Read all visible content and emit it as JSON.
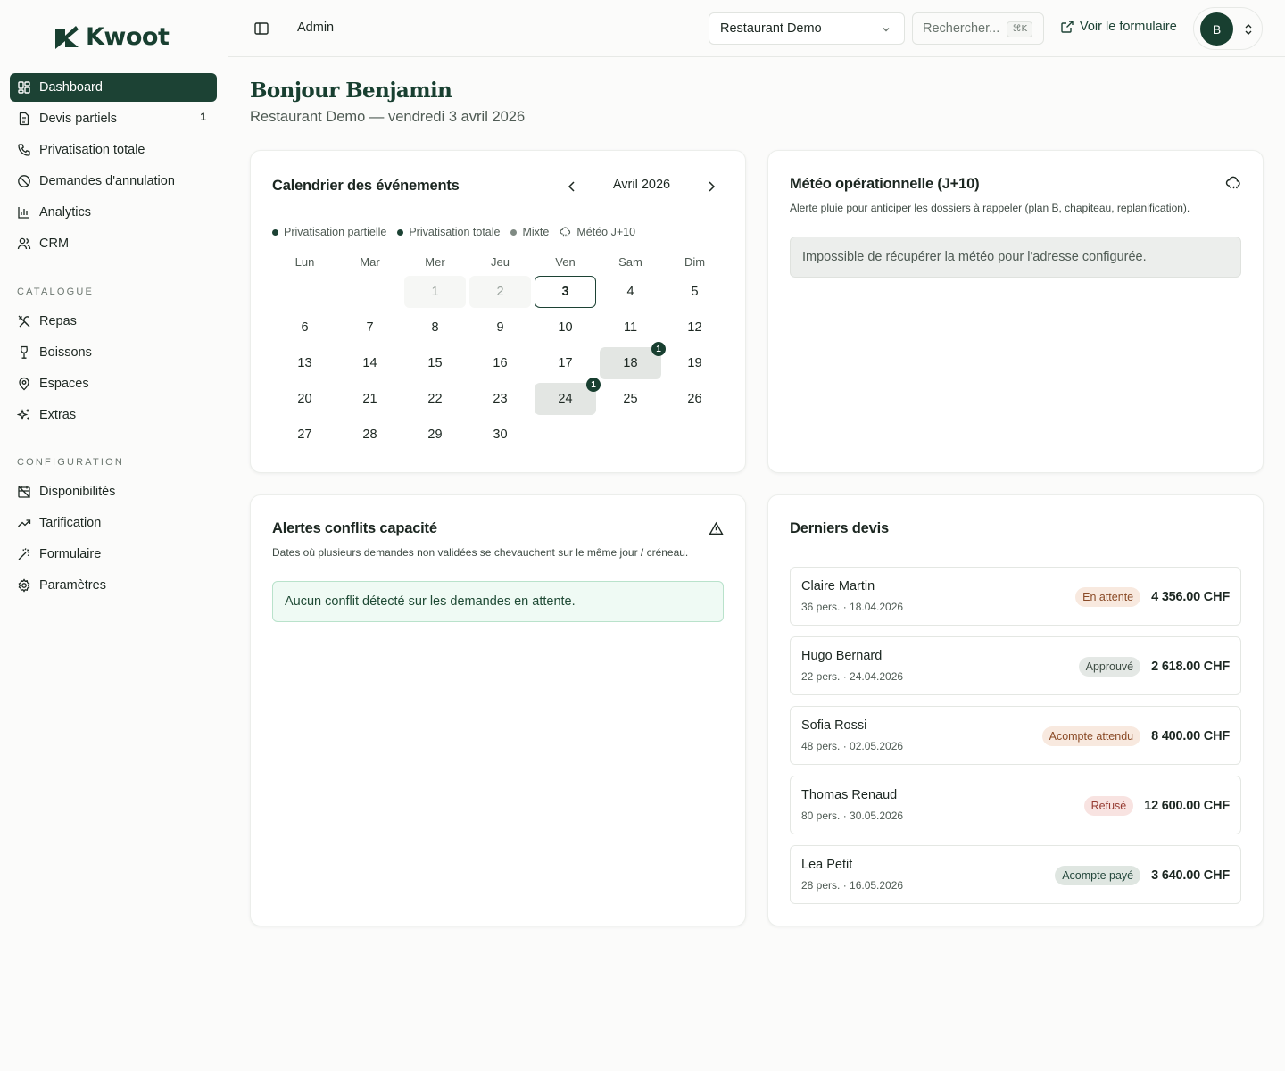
{
  "brand": {
    "name": "Kwoot",
    "color": "#183f30"
  },
  "sidebar": {
    "items": [
      {
        "label": "Dashboard",
        "icon": "dashboard-icon",
        "active": true
      },
      {
        "label": "Devis partiels",
        "icon": "file-text-icon",
        "badge": "1"
      },
      {
        "label": "Privatisation totale",
        "icon": "phone-icon"
      },
      {
        "label": "Demandes d'annulation",
        "icon": "ban-icon"
      },
      {
        "label": "Analytics",
        "icon": "bar-chart-icon"
      },
      {
        "label": "CRM",
        "icon": "users-icon"
      }
    ],
    "catalogue_title": "CATALOGUE",
    "catalogue": [
      {
        "label": "Repas",
        "icon": "utensils-icon"
      },
      {
        "label": "Boissons",
        "icon": "wine-icon"
      },
      {
        "label": "Espaces",
        "icon": "map-pin-icon"
      },
      {
        "label": "Extras",
        "icon": "sparkles-icon"
      }
    ],
    "config_title": "CONFIGURATION",
    "config": [
      {
        "label": "Disponibilités",
        "icon": "calendar-off-icon"
      },
      {
        "label": "Tarification",
        "icon": "trending-up-icon"
      },
      {
        "label": "Formulaire",
        "icon": "magic-wand-icon"
      },
      {
        "label": "Paramètres",
        "icon": "settings-icon"
      }
    ]
  },
  "topbar": {
    "title": "Admin",
    "restaurant": "Restaurant Demo",
    "search_placeholder": "Rechercher...",
    "search_shortcut": "⌘K",
    "form_link": "Voir le formulaire",
    "avatar_initial": "B"
  },
  "header": {
    "greeting": "Bonjour Benjamin",
    "subtitle": "Restaurant Demo — vendredi 3 avril 2026"
  },
  "calendar": {
    "title": "Calendrier des événements",
    "month": "Avril 2026",
    "legend": [
      {
        "label": "Privatisation partielle",
        "color": "#1c4234"
      },
      {
        "label": "Privatisation totale",
        "color": "#1c4234"
      },
      {
        "label": "Mixte",
        "color": "#7f8a83"
      },
      {
        "label": "Météo J+10",
        "icon": "cloud-rain-icon"
      }
    ],
    "weekdays": [
      "Lun",
      "Mar",
      "Mer",
      "Jeu",
      "Ven",
      "Sam",
      "Dim"
    ],
    "start_weekday_index": 2,
    "days": [
      "1",
      "2",
      "3",
      "4",
      "5",
      "6",
      "7",
      "8",
      "9",
      "10",
      "11",
      "12",
      "13",
      "14",
      "15",
      "16",
      "17",
      "18",
      "19",
      "20",
      "21",
      "22",
      "23",
      "24",
      "25",
      "26",
      "27",
      "28",
      "29",
      "30"
    ],
    "past_days": [
      "1",
      "2"
    ],
    "today": "3",
    "events": {
      "18": "1",
      "24": "1"
    }
  },
  "weather": {
    "title": "Météo opérationnelle (J+10)",
    "subtitle": "Alerte pluie pour anticiper les dossiers à rappeler (plan B, chapiteau, replanification).",
    "message": "Impossible de récupérer la météo pour l'adresse configurée."
  },
  "conflicts": {
    "title": "Alertes conflits capacité",
    "subtitle": "Dates où plusieurs demandes non validées se chevauchent sur le même jour / créneau.",
    "message": "Aucun conflit détecté sur les demandes en attente."
  },
  "quotes": {
    "title": "Derniers devis",
    "items": [
      {
        "name": "Claire Martin",
        "meta": "36 pers. · 18.04.2026",
        "status": "En attente",
        "status_bg": "#f8e9df",
        "status_fg": "#8a4a26",
        "amount": "4 356.00 CHF"
      },
      {
        "name": "Hugo Bernard",
        "meta": "22 pers. · 24.04.2026",
        "status": "Approuvé",
        "status_bg": "#e4e8e5",
        "status_fg": "#3b4a41",
        "amount": "2 618.00 CHF"
      },
      {
        "name": "Sofia Rossi",
        "meta": "48 pers. · 02.05.2026",
        "status": "Acompte attendu",
        "status_bg": "#f8e9df",
        "status_fg": "#8a4a26",
        "amount": "8 400.00 CHF"
      },
      {
        "name": "Thomas Renaud",
        "meta": "80 pers. · 30.05.2026",
        "status": "Refusé",
        "status_bg": "#f8e3e1",
        "status_fg": "#963c33",
        "amount": "12 600.00 CHF"
      },
      {
        "name": "Lea Petit",
        "meta": "28 pers. · 16.05.2026",
        "status": "Acompte payé",
        "status_bg": "#dfe6e1",
        "status_fg": "#22463a",
        "amount": "3 640.00 CHF"
      }
    ]
  }
}
